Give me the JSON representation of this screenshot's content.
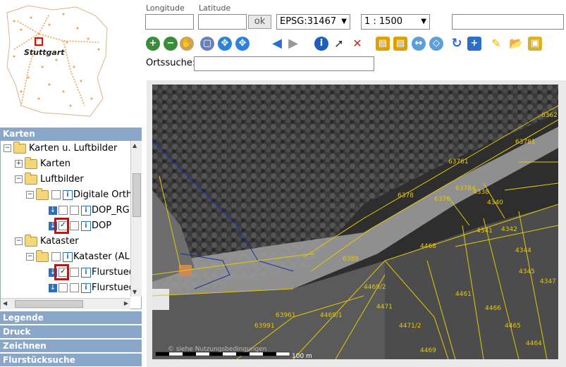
{
  "overview": {
    "city_label": "Stuttgart"
  },
  "panel": {
    "title": "Karten",
    "tree": [
      {
        "label": "Karten u. Luftbilder"
      },
      {
        "label": "Karten"
      },
      {
        "label": "Luftbilder"
      },
      {
        "label": "Digitale Orth"
      },
      {
        "label": "DOP_RGB"
      },
      {
        "label": "DOP"
      },
      {
        "label": "Kataster"
      },
      {
        "label": "Kataster (AL"
      },
      {
        "label": "Flurstued"
      },
      {
        "label": "Flurstued"
      }
    ],
    "accordion": [
      "Legende",
      "Druck",
      "Zeichnen",
      "Flurstücksuche"
    ]
  },
  "toolbar": {
    "longitude_label": "Longitude",
    "latitude_label": "Latitude",
    "longitude_value": "",
    "latitude_value": "",
    "ok_label": "ok",
    "epsg_value": "EPSG:31467",
    "scale_value": "1 : 1500",
    "search_label": "Ortssuche:",
    "search_value": ""
  },
  "map": {
    "attribution": "© siehe Nutzungsbedingungen",
    "scalebar": "100 m",
    "parcels": [
      "6362",
      "63781",
      "63761",
      "6378",
      "6376",
      "63784",
      "4338",
      "4340",
      "4341",
      "4342",
      "4344",
      "4345",
      "4347",
      "4468",
      "4469/2",
      "4469/1",
      "6389",
      "4471",
      "4471/2",
      "4461",
      "4466",
      "4465",
      "4464",
      "63991",
      "63961",
      "4469"
    ]
  },
  "colors": {
    "panel_header": "#8aa6c9",
    "parcel_line": "#e6c800",
    "highlight": "#ee0000"
  }
}
